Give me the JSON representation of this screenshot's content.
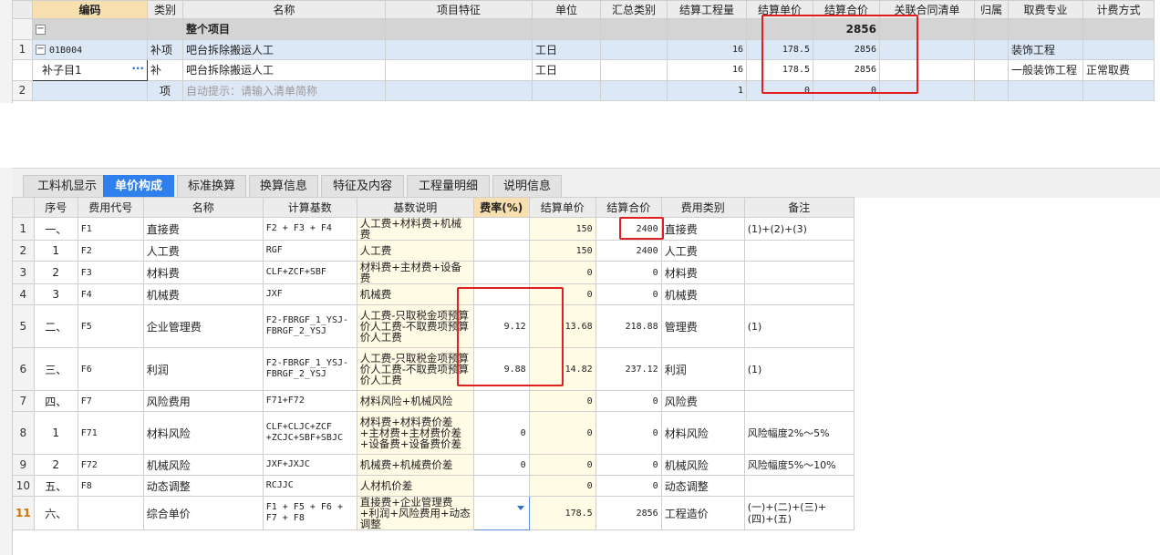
{
  "top_grid": {
    "headers": [
      "编码",
      "类别",
      "名称",
      "项目特征",
      "单位",
      "汇总类别",
      "结算工程量",
      "结算单价",
      "结算合价",
      "关联合同清单",
      "归属",
      "取费专业",
      "计费方式"
    ],
    "total_row": {
      "label": "整个项目",
      "total": "2856",
      "toggle": "−"
    },
    "rows": [
      {
        "rownum": "1",
        "code": "01B004",
        "type": "补项",
        "name": "吧台拆除搬运人工",
        "feature": "",
        "unit": "工日",
        "sum_cat": "",
        "qty": "16",
        "price": "178.5",
        "amount": "2856",
        "contract": "",
        "owner": "",
        "fee_spec": "装饰工程",
        "fee_method": "",
        "toggle": "−"
      },
      {
        "rownum": "",
        "code": "补子目1",
        "type": "补",
        "name": "吧台拆除搬运人工",
        "feature": "",
        "unit": "工日",
        "sum_cat": "",
        "qty": "16",
        "price": "178.5",
        "amount": "2856",
        "contract": "",
        "owner": "",
        "fee_spec": "一般装饰工程",
        "fee_method": "正常取费",
        "dots": "···"
      },
      {
        "rownum": "2",
        "code": "",
        "type": "项",
        "name": "自动提示：请输入清单简称",
        "feature": "",
        "unit": "",
        "sum_cat": "",
        "qty": "1",
        "price": "0",
        "amount": "0",
        "contract": "",
        "owner": "",
        "fee_spec": "",
        "fee_method": ""
      }
    ]
  },
  "tabs": [
    "工料机显示",
    "单价构成",
    "标准换算",
    "换算信息",
    "特征及内容",
    "工程量明细",
    "说明信息"
  ],
  "active_tab": "单价构成",
  "bottom_grid": {
    "headers": [
      "序号",
      "费用代号",
      "名称",
      "计算基数",
      "基数说明",
      "费率(%)",
      "结算单价",
      "结算合价",
      "费用类别",
      "备注"
    ],
    "rows": [
      {
        "rownum": "1",
        "seq": "一、",
        "code": "F1",
        "name": "直接费",
        "base": "F2 + F3 + F4",
        "desc": "人工费+材料费+机械费",
        "rate": "",
        "unit_price": "150",
        "total": "2400",
        "category": "直接费",
        "remark": "(1)+(2)+(3)"
      },
      {
        "rownum": "2",
        "seq": "1",
        "code": "F2",
        "name": "人工费",
        "base": "RGF",
        "desc": "人工费",
        "rate": "",
        "unit_price": "150",
        "total": "2400",
        "category": "人工费",
        "remark": ""
      },
      {
        "rownum": "3",
        "seq": "2",
        "code": "F3",
        "name": "材料费",
        "base": "CLF+ZCF+SBF",
        "desc": "材料费+主材费+设备费",
        "rate": "",
        "unit_price": "0",
        "total": "0",
        "category": "材料费",
        "remark": ""
      },
      {
        "rownum": "4",
        "seq": "3",
        "code": "F4",
        "name": "机械费",
        "base": "JXF",
        "desc": "机械费",
        "rate": "",
        "unit_price": "0",
        "total": "0",
        "category": "机械费",
        "remark": ""
      },
      {
        "rownum": "5",
        "seq": "二、",
        "code": "F5",
        "name": "企业管理费",
        "base": "F2-FBRGF_1_YSJ-FBRGF_2_YSJ",
        "desc": "人工费-只取税金项预算价人工费-不取费项预算价人工费",
        "rate": "9.12",
        "unit_price": "13.68",
        "total": "218.88",
        "category": "管理费",
        "remark": "(1)"
      },
      {
        "rownum": "6",
        "seq": "三、",
        "code": "F6",
        "name": "利润",
        "base": "F2-FBRGF_1_YSJ-FBRGF_2_YSJ",
        "desc": "人工费-只取税金项预算价人工费-不取费项预算价人工费",
        "rate": "9.88",
        "unit_price": "14.82",
        "total": "237.12",
        "category": "利润",
        "remark": "(1)"
      },
      {
        "rownum": "7",
        "seq": "四、",
        "code": "F7",
        "name": "风险费用",
        "base": "F71+F72",
        "desc": "材料风险+机械风险",
        "rate": "",
        "unit_price": "0",
        "total": "0",
        "category": "风险费",
        "remark": ""
      },
      {
        "rownum": "8",
        "seq": "1",
        "code": "F71",
        "name": "材料风险",
        "base": "CLF+CLJC+ZCF +ZCJC+SBF+SBJC",
        "desc": "材料费+材料费价差+主材费+主材费价差+设备费+设备费价差",
        "rate": "0",
        "unit_price": "0",
        "total": "0",
        "category": "材料风险",
        "remark": "风险幅度2%～5%"
      },
      {
        "rownum": "9",
        "seq": "2",
        "code": "F72",
        "name": "机械风险",
        "base": "JXF+JXJC",
        "desc": "机械费+机械费价差",
        "rate": "0",
        "unit_price": "0",
        "total": "0",
        "category": "机械风险",
        "remark": "风险幅度5%～10%"
      },
      {
        "rownum": "10",
        "seq": "五、",
        "code": "F8",
        "name": "动态调整",
        "base": "RCJJC",
        "desc": "人材机价差",
        "rate": "",
        "unit_price": "0",
        "total": "0",
        "category": "动态调整",
        "remark": ""
      },
      {
        "rownum": "11",
        "seq": "六、",
        "code": "",
        "name": "综合单价",
        "base": "F1 + F5 + F6 + F7 + F8",
        "desc": "直接费+企业管理费+利润+风险费用+动态调整",
        "rate": "",
        "unit_price": "178.5",
        "total": "2856",
        "category": "工程造价",
        "remark": "(一)+(二)+(三)+(四)+(五)"
      }
    ]
  },
  "colors": {
    "highlight_box": "#e02020",
    "active_tab": "#2f80ed",
    "selected_header": "#f7dfb0"
  }
}
